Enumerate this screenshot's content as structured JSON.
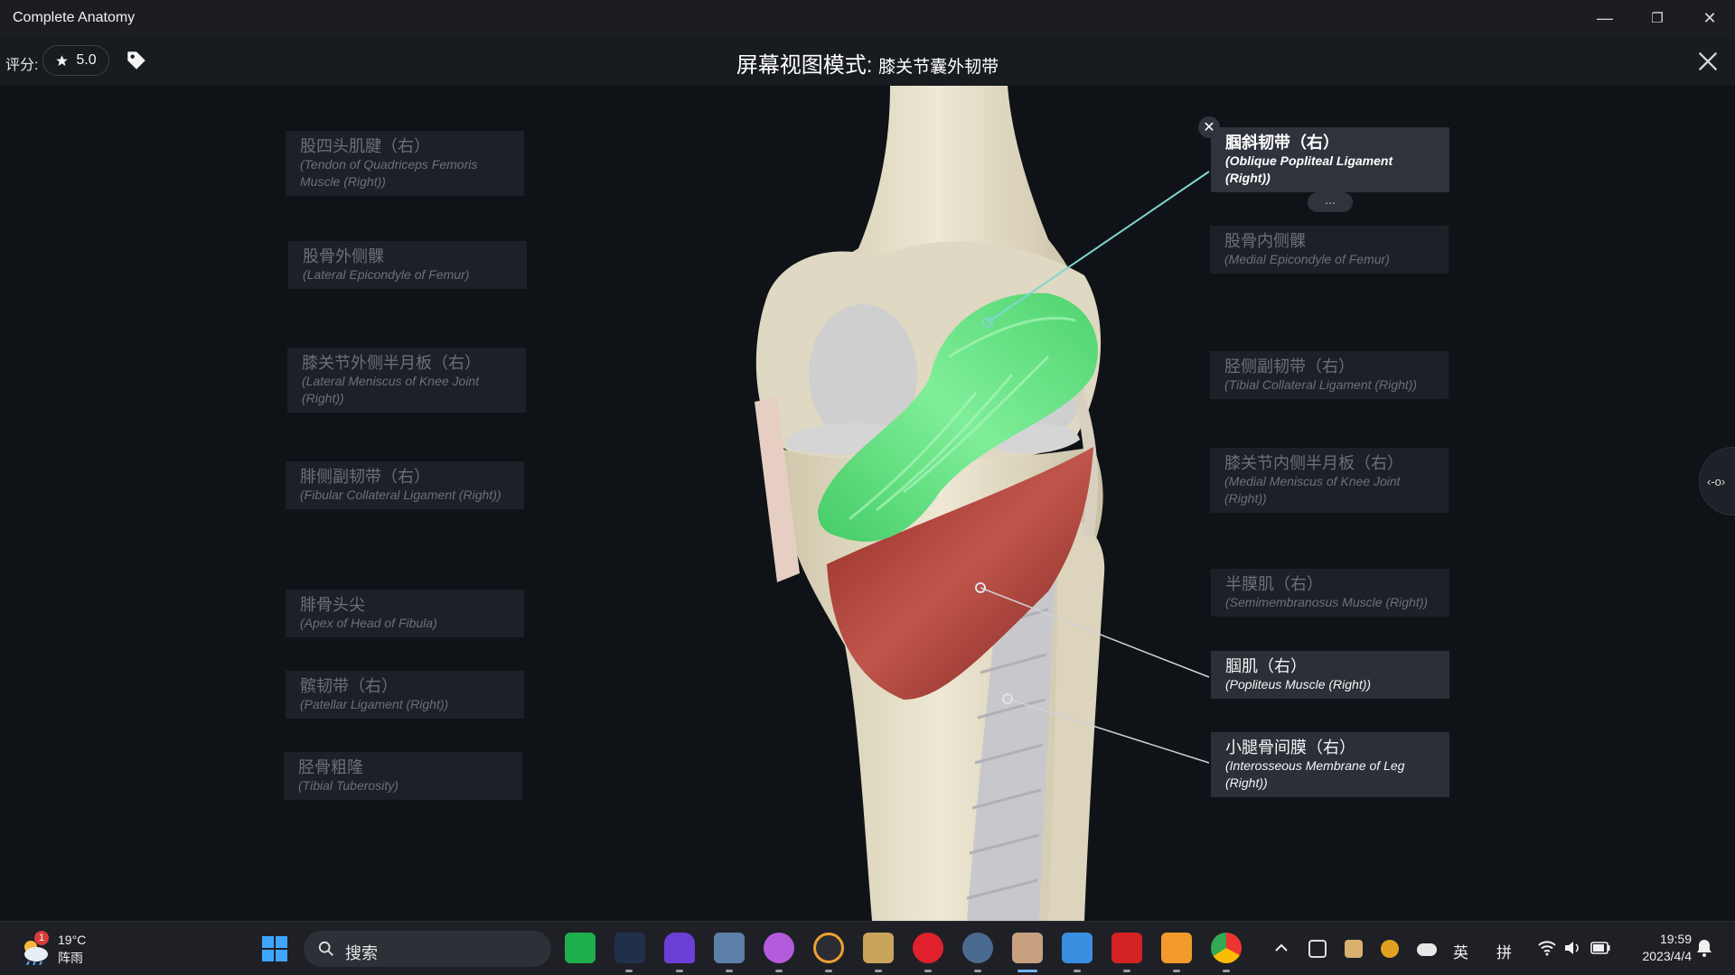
{
  "window": {
    "title": "Complete Anatomy",
    "controls": {
      "minimize": "—",
      "restore": "❐",
      "close": "✕"
    }
  },
  "toolbar": {
    "rating_label": "评分:",
    "rating_value": "5.0",
    "rating_icon": "star-icon",
    "tag_icon": "tag-icon",
    "view_mode_label": "屏幕视图模式:",
    "view_mode_name": "膝关节囊外韧带",
    "close_icon": "close-icon"
  },
  "labels_left": [
    {
      "cn": "股四头肌腱（右）",
      "en": "(Tendon of Quadriceps Femoris Muscle (Right))"
    },
    {
      "cn": "股骨外侧髁",
      "en": "(Lateral Epicondyle of Femur)"
    },
    {
      "cn": "膝关节外侧半月板（右）",
      "en": "(Lateral Meniscus of Knee Joint (Right))"
    },
    {
      "cn": "腓侧副韧带（右）",
      "en": "(Fibular Collateral Ligament (Right))"
    },
    {
      "cn": "腓骨头尖",
      "en": "(Apex of Head of Fibula)"
    },
    {
      "cn": "髌韧带（右）",
      "en": "(Patellar Ligament (Right))"
    },
    {
      "cn": "胫骨粗隆",
      "en": "(Tibial Tuberosity)"
    }
  ],
  "labels_right": [
    {
      "cn": "腘斜韧带（右）",
      "en": "(Oblique Popliteal Ligament (Right))",
      "state": "selected"
    },
    {
      "cn": "股骨内侧髁",
      "en": "(Medial Epicondyle of Femur)",
      "state": "inactive"
    },
    {
      "cn": "胫侧副韧带（右）",
      "en": "(Tibial Collateral Ligament (Right))",
      "state": "inactive"
    },
    {
      "cn": "膝关节内侧半月板（右）",
      "en": "(Medial Meniscus of Knee Joint (Right))",
      "state": "inactive"
    },
    {
      "cn": "半膜肌（右）",
      "en": "(Semimembranosus Muscle (Right))",
      "state": "inactive"
    },
    {
      "cn": "腘肌（右）",
      "en": "(Popliteus Muscle (Right))",
      "state": "active"
    },
    {
      "cn": "小腿骨间膜（右）",
      "en": "(Interosseous Membrane of Leg (Right))",
      "state": "active"
    }
  ],
  "selected_close": "✕",
  "more_button": "...",
  "side_handle": "‹-o›",
  "colors": {
    "ligament_highlight": "#5fe07e",
    "muscle": "#b8423a",
    "bone": "#e8e0c8",
    "leader_line_selected": "#7fd6d0",
    "leader_line_active": "#cfd3d8"
  },
  "taskbar": {
    "weather": {
      "temp": "19°C",
      "cond": "阵雨",
      "badge": "1",
      "icon": "weather-cloud-icon"
    },
    "start_icon": "windows-start-icon",
    "search_placeholder": "搜索",
    "search_icon": "search-icon",
    "apps": [
      "app-green-icon",
      "app-blue-cat-icon",
      "app-purple-gem-icon",
      "app-photo-icon",
      "app-pink-ball-icon",
      "app-g-icon",
      "app-book-icon",
      "app-netease-music-icon",
      "app-settings-icon",
      "app-complete-anatomy-icon",
      "app-pictures-icon",
      "app-acrobat-icon",
      "app-sketch-icon",
      "app-chrome-icon"
    ],
    "tray": {
      "chevron_icon": "chevron-up-icon",
      "ime_lang": "英",
      "ime_mode": "拼",
      "wifi_icon": "wifi-icon",
      "volume_icon": "volume-icon",
      "battery_icon": "battery-icon"
    },
    "clock_time": "19:59",
    "clock_date": "2023/4/4",
    "notification_icon": "notification-icon"
  }
}
